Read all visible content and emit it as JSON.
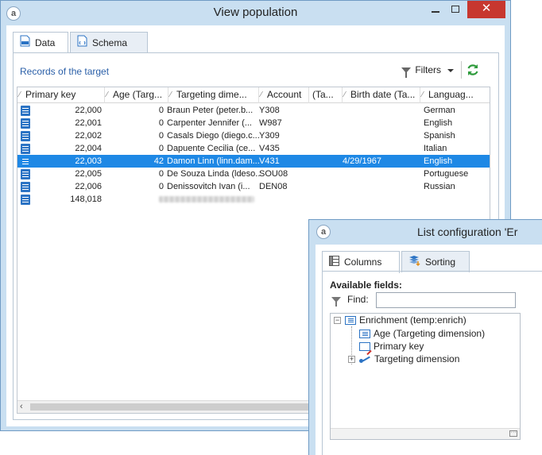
{
  "main_window": {
    "title": "View population",
    "icon": "app-logo-icon",
    "controls": {
      "minimize": "minimize",
      "maximize": "maximize",
      "close": "✕"
    },
    "tabs": [
      {
        "label": "Data",
        "icon": "sql-icon"
      },
      {
        "label": "Schema",
        "icon": "schema-icon"
      }
    ],
    "records_title": "Records of the target",
    "filters_label": "Filters",
    "columns": [
      "Primary key",
      "Age (Targ...",
      "Targeting dime...",
      "Account",
      "(Ta...",
      "Birth date (Ta...",
      "Languag..."
    ],
    "rows": [
      {
        "key": "22,000",
        "age": "0",
        "targeting": "Braun Peter (peter.b...",
        "account": "Y308",
        "birth": "",
        "language": "German",
        "selected": false
      },
      {
        "key": "22,001",
        "age": "0",
        "targeting": "Carpenter Jennifer (...",
        "account": "W987",
        "birth": "",
        "language": "English",
        "selected": false
      },
      {
        "key": "22,002",
        "age": "0",
        "targeting": "Casals Diego (diego.c...",
        "account": "Y309",
        "birth": "",
        "language": "Spanish",
        "selected": false
      },
      {
        "key": "22,004",
        "age": "0",
        "targeting": "Dapuente Cecilia (ce...",
        "account": "V435",
        "birth": "",
        "language": "Italian",
        "selected": false
      },
      {
        "key": "22,003",
        "age": "42",
        "targeting": "Damon Linn (linn.dam...",
        "account": "V431",
        "birth": "4/29/1967",
        "language": "English",
        "selected": true
      },
      {
        "key": "22,005",
        "age": "0",
        "targeting": "De Souza Linda (ldeso...",
        "account": "SOU08",
        "birth": "",
        "language": "Portuguese",
        "selected": false
      },
      {
        "key": "22,006",
        "age": "0",
        "targeting": "Denissovitch Ivan (i...",
        "account": "DEN08",
        "birth": "",
        "language": "Russian",
        "selected": false
      },
      {
        "key": "148,018",
        "age": "",
        "targeting": "",
        "account": "",
        "birth": "",
        "language": "",
        "selected": false
      }
    ]
  },
  "config_window": {
    "title": "List configuration 'Er",
    "tabs": [
      {
        "label": "Columns",
        "icon": "grid-icon"
      },
      {
        "label": "Sorting",
        "icon": "sort-icon"
      }
    ],
    "available_fields_label": "Available fields:",
    "find_label": "Find:",
    "find_value": "",
    "tree": {
      "root": "Enrichment (temp:enrich)",
      "children": [
        "Age (Targeting dimension)",
        "Primary key",
        "Targeting dimension"
      ]
    }
  }
}
